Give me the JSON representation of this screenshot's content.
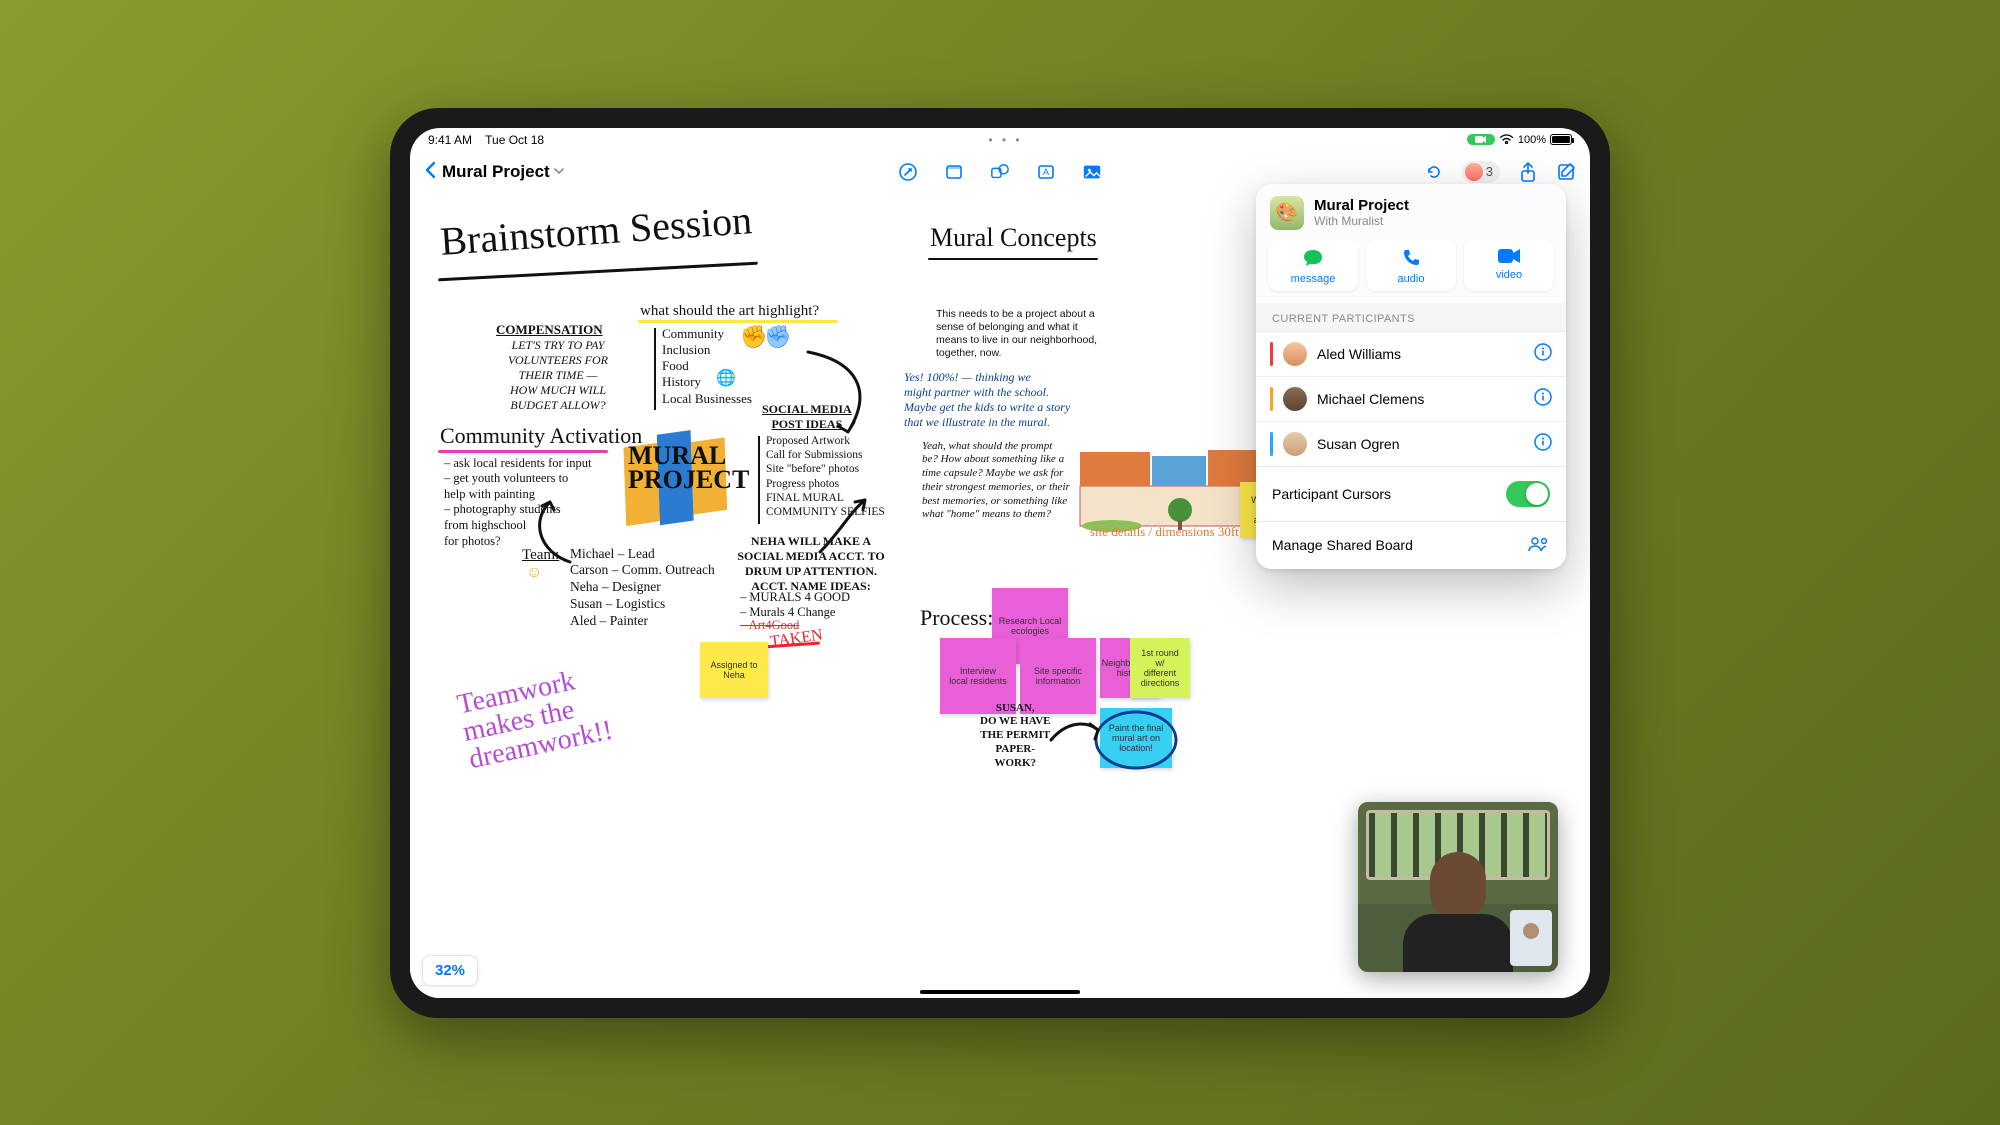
{
  "status": {
    "time": "9:41 AM",
    "date": "Tue Oct 18",
    "battery_pct": "100%",
    "center_dots": "• • •"
  },
  "toolbar": {
    "title": "Mural Project",
    "collab_count": "3"
  },
  "popover": {
    "title": "Mural Project",
    "subtitle": "With Muralist",
    "actions": {
      "message": "message",
      "audio": "audio",
      "video": "video"
    },
    "participants_header": "CURRENT PARTICIPANTS",
    "participants": [
      {
        "name": "Aled Williams",
        "color": "#f23b3b"
      },
      {
        "name": "Michael Clemens",
        "color": "#f5a623"
      },
      {
        "name": "Susan Ogren",
        "color": "#2aa8ff"
      }
    ],
    "cursor_row": "Participant Cursors",
    "manage_row": "Manage Shared Board"
  },
  "zoom": "32%",
  "canvas": {
    "title_left": "Brainstorm Session",
    "title_right": "Mural Concepts",
    "compensation_h": "COMPENSATION",
    "compensation_body": "LET'S TRY TO PAY\nVOLUNTEERS FOR\nTHEIR TIME —\nHOW MUCH WILL\nBUDGET ALLOW?",
    "art_q": "what should the art highlight?",
    "art_list": "Community\nInclusion\nFood\nHistory\nLocal Businesses",
    "community_h": "Community Activation",
    "community_body": "– ask local residents for input\n– get youth volunteers to\n   help with painting\n– photography students\n   from highschool\n   for photos?",
    "team_h": "Team:",
    "team_body": "Michael – Lead\nCarson – Comm. Outreach\nNeha – Designer\nSusan – Logistics\nAled – Painter",
    "social_h": "SOCIAL MEDIA\nPOST IDEAS",
    "social_body": "Proposed Artwork\nCall for Submissions\nSite \"before\" photos\nProgress photos\nFINAL MURAL\nCOMMUNITY SELFIES",
    "acct_h": "NEHA WILL MAKE A\nSOCIAL MEDIA ACCT. TO\nDRUM UP ATTENTION.\nACCT. NAME IDEAS:",
    "acct_body": "– MURALS 4 GOOD\n– Murals 4 Change",
    "acct_taken": "– Art4Good",
    "taken_tag": "TAKEN",
    "mural_text": "MURAL\nPROJECT",
    "teamwork": "Teamwork\nmakes the\ndreamwork!!",
    "concept_para": "This needs to be a project about a\nsense of belonging and what it\nmeans to live in our neighborhood,\ntogether, now.",
    "concept_yes": "Yes! 100%! — thinking we\nmight partner with the school.\nMaybe get the kids to write a story\nthat we illustrate in the mural.",
    "concept_prompt": "Yeah, what should the prompt\nbe? How about something like a\ntime capsule? Maybe we ask for\ntheir strongest memories, or their\nbest memories, or something like\nwhat \"home\" means to them?",
    "process_h": "Process:",
    "susan_note": "SUSAN,\nDO WE HAVE\nTHE PERMIT\nPAPER-\nWORK?",
    "illus_caption": "site details / dimensions 30ft",
    "sticky": {
      "assigned": "Assigned to\nNeha",
      "wow": "Wow! This\nlooks amazing!",
      "research": "Research Local\necologies",
      "interview": "Interview\nlocal residents",
      "sitespec": "Site specific\ninformation",
      "hood": "Neighborhood\nhistory",
      "round1": "1st round w/\ndifferent\ndirections",
      "paint": "Paint the final\nmural art on\nlocation!"
    }
  }
}
